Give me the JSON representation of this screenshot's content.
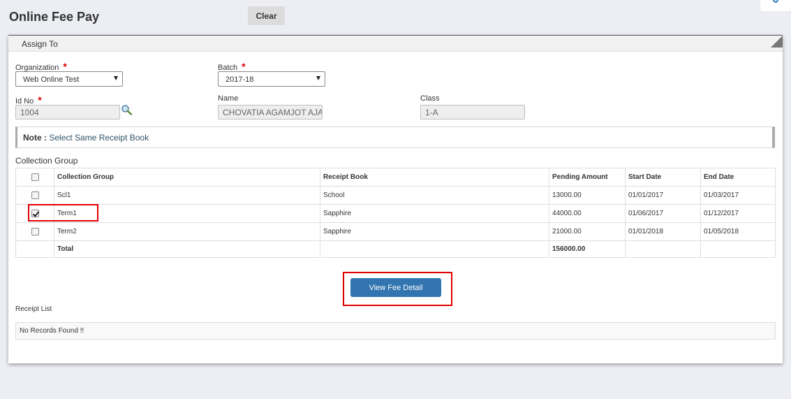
{
  "header": {
    "title": "Online Fee Pay",
    "clear_label": "Clear"
  },
  "panel": {
    "title": "Assign To",
    "organization": {
      "label": "Organization",
      "required": "*",
      "value": "Web Online Test"
    },
    "batch": {
      "label": "Batch",
      "required": "*",
      "value": "2017-18"
    },
    "id_no": {
      "label": "Id No",
      "required": "*",
      "value": "1004"
    },
    "name": {
      "label": "Name",
      "value": "CHOVATIA AGAMJOT AJA"
    },
    "class": {
      "label": "Class",
      "value": "1-A"
    },
    "note": {
      "label": "Note :",
      "text": "Select Same Receipt Book"
    },
    "collection_group_label": "Collection Group",
    "table": {
      "headers": [
        "Collection Group",
        "Receipt Book",
        "Pending Amount",
        "Start Date",
        "End Date"
      ],
      "rows": [
        {
          "group": "Scl1",
          "book": "School",
          "amount": "13000.00",
          "start": "01/01/2017",
          "end": "01/03/2017",
          "checked": false
        },
        {
          "group": "Term1",
          "book": "Sapphire",
          "amount": "44000.00",
          "start": "01/06/2017",
          "end": "01/12/2017",
          "checked": true
        },
        {
          "group": "Term2",
          "book": "Sapphire",
          "amount": "21000.00",
          "start": "01/01/2018",
          "end": "01/05/2018",
          "checked": false
        }
      ],
      "total_label": "Total",
      "total_amount": "156000.00"
    },
    "view_button_label": "View Fee Detail",
    "receipt_list_label": "Receipt List",
    "receipt_empty_text": "No Records Found !!"
  },
  "colors": {
    "primary_button": "#3375b1",
    "highlight": "#e00000",
    "required": "#dd0000"
  }
}
